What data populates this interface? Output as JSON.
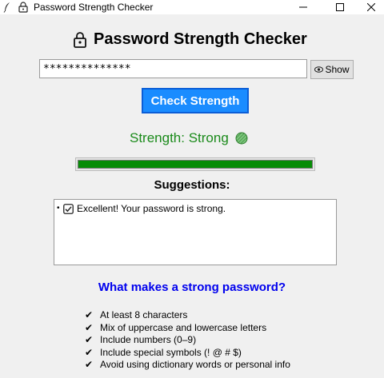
{
  "window": {
    "title": "Password Strength Checker"
  },
  "header": {
    "title": "Password Strength Checker"
  },
  "password": {
    "value": "**************"
  },
  "show_button": {
    "label": "Show"
  },
  "check_button": {
    "label": "Check Strength"
  },
  "strength": {
    "text": "Strength: Strong",
    "color": "#1a8a1a",
    "progress_fraction": 1.0,
    "bar_color": "#078c07"
  },
  "suggestions": {
    "title": "Suggestions:",
    "items": [
      {
        "bullet": "•",
        "text": "Excellent! Your password is strong."
      }
    ]
  },
  "info": {
    "title": "What makes a strong password?",
    "tips": [
      "At least 8 characters",
      "Mix of uppercase and lowercase letters",
      "Include numbers (0–9)",
      "Include special symbols (! @ # $)",
      "Avoid using dictionary words or personal info"
    ],
    "tip_mark": "✔"
  },
  "colors": {
    "accent": "#1a8cff",
    "link_blue": "#0000ee"
  }
}
